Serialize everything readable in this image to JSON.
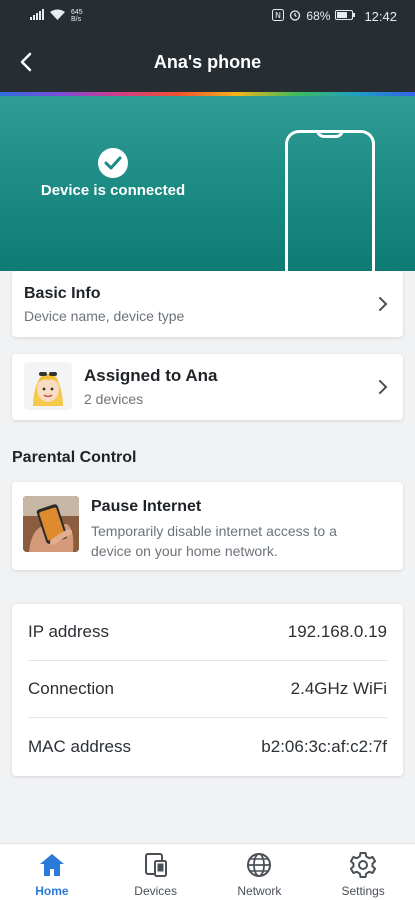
{
  "status_bar": {
    "net_speed_value": "645",
    "net_speed_unit": "B/s",
    "battery": "68%",
    "time": "12:42"
  },
  "header": {
    "title": "Ana's phone"
  },
  "hero": {
    "status_text": "Device is connected"
  },
  "basic_info": {
    "title": "Basic Info",
    "subtitle": "Device name, device type"
  },
  "assigned": {
    "title": "Assigned to Ana",
    "subtitle": "2 devices"
  },
  "parental_control": {
    "section_title": "Parental Control",
    "pause_title": "Pause Internet",
    "pause_desc_line1": "Temporarily disable internet access to a",
    "pause_desc_line2": "device on your home network."
  },
  "details": [
    {
      "label": "IP address",
      "value": "192.168.0.19"
    },
    {
      "label": "Connection",
      "value": "2.4GHz WiFi"
    },
    {
      "label": "MAC address",
      "value": "b2:06:3c:af:c2:7f"
    }
  ],
  "nav": [
    {
      "label": "Home",
      "icon": "home-icon",
      "active": true
    },
    {
      "label": "Devices",
      "icon": "devices-icon",
      "active": false
    },
    {
      "label": "Network",
      "icon": "globe-icon",
      "active": false
    },
    {
      "label": "Settings",
      "icon": "gear-icon",
      "active": false
    }
  ],
  "colors": {
    "header_bg": "#262d33",
    "hero_teal": "#1a8a82",
    "accent_blue": "#2a7bd8"
  }
}
